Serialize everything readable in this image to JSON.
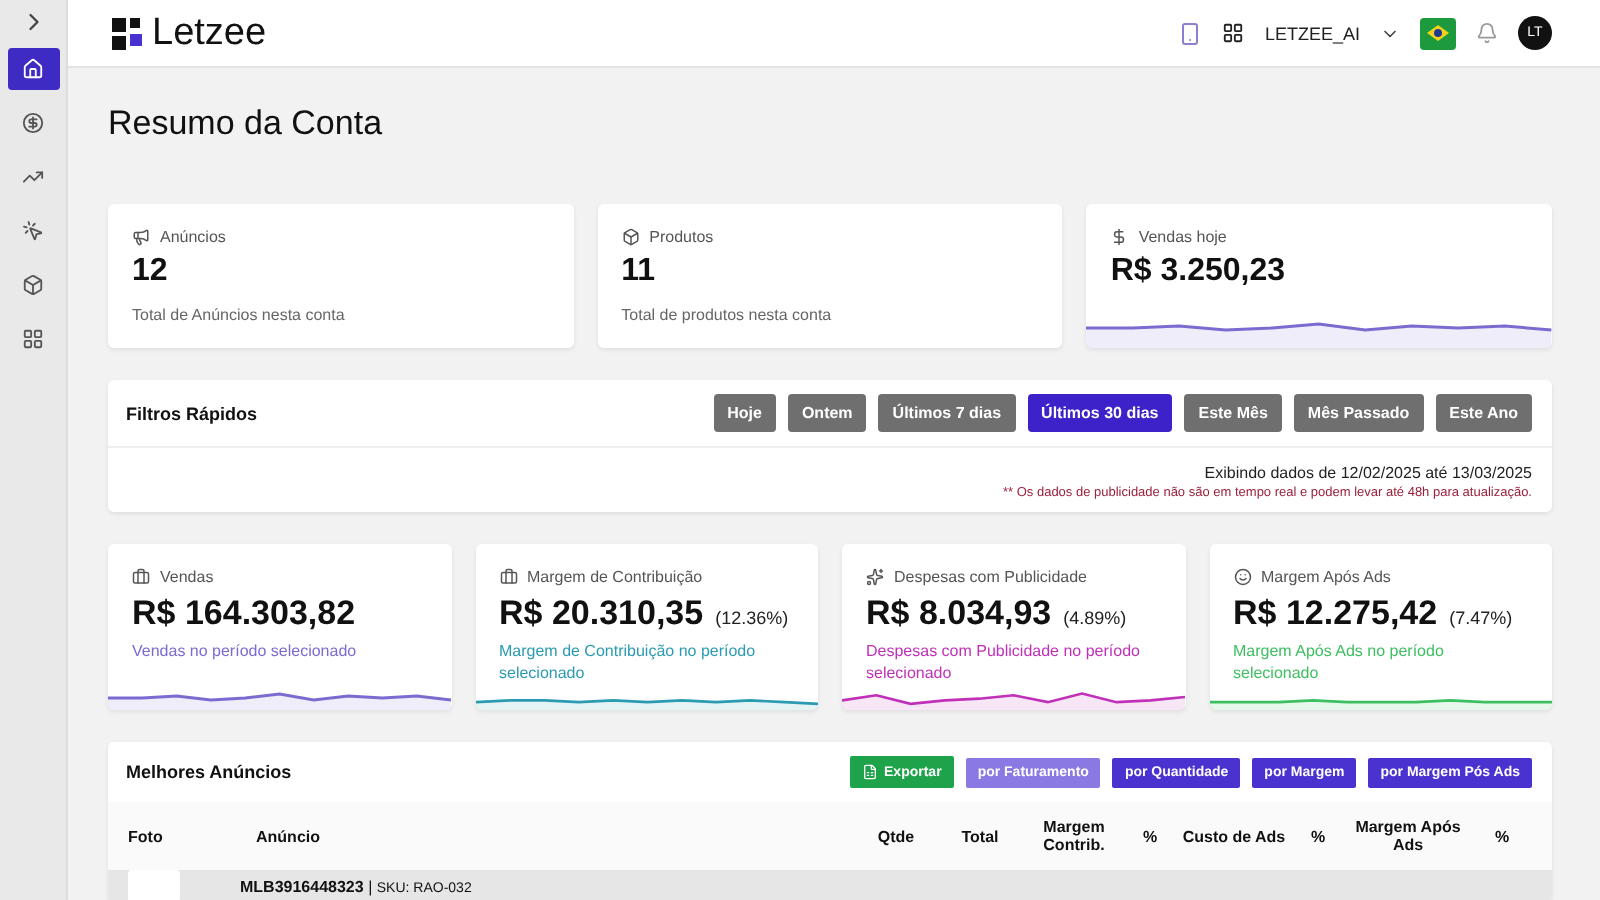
{
  "header": {
    "logo": "Letzee",
    "account": "LETZEE_AI",
    "avatar": "LT"
  },
  "sidebar": {
    "items": [
      {
        "kind": "home",
        "selected": true
      },
      {
        "kind": "money",
        "selected": false
      },
      {
        "kind": "trend",
        "selected": false
      },
      {
        "kind": "click",
        "selected": false
      },
      {
        "kind": "box",
        "selected": false
      },
      {
        "kind": "grid",
        "selected": false
      }
    ]
  },
  "title": "Resumo da Conta",
  "summary_cards": [
    {
      "kind": "ads",
      "label": "Anúncios",
      "value": "12",
      "note": "Total de Anúncios nesta conta"
    },
    {
      "kind": "products",
      "label": "Produtos",
      "value": "11",
      "note": "Total de produtos nesta conta"
    },
    {
      "kind": "sales",
      "label": "Vendas hoje",
      "value": "R$ 3.250,23"
    }
  ],
  "quick_filters": {
    "title": "Filtros Rápidos",
    "buttons": [
      {
        "label": "Hoje",
        "selected": false
      },
      {
        "label": "Ontem",
        "selected": false
      },
      {
        "label": "Últimos 7 dias",
        "selected": false
      },
      {
        "label": "Últimos 30 dias",
        "selected": true
      },
      {
        "label": "Este Mês",
        "selected": false
      },
      {
        "label": "Mês Passado",
        "selected": false
      },
      {
        "label": "Este Ano",
        "selected": false
      }
    ],
    "range": "Exibindo dados de 12/02/2025 até 13/03/2025",
    "notice": "** Os dados de publicidade não são em tempo real e podem levar até 48h para atualização."
  },
  "metrics": [
    {
      "kind": "sales",
      "label": "Vendas",
      "value": "R$ 164.303,82",
      "note": "Vendas no período selecionado",
      "color": "#7b6bd0"
    },
    {
      "kind": "margin",
      "label": "Margem de Contribuição",
      "value": "R$ 20.310,35",
      "percent": "(12.36%)",
      "note": "Margem de Contribuição no período selecionado",
      "color": "#2a9bb0"
    },
    {
      "kind": "ads",
      "label": "Despesas com Publicidade",
      "value": "R$ 8.034,93",
      "percent": "(4.89%)",
      "note": "Despesas com Publicidade no período selecionado",
      "color": "#c030b8"
    },
    {
      "kind": "after",
      "label": "Margem Após Ads",
      "value": "R$ 12.275,42",
      "percent": "(7.47%)",
      "note": "Margem Após Ads no período selecionado",
      "color": "#3cbf60"
    }
  ],
  "best_ads": {
    "title": "Melhores Anúncios",
    "export": "Exportar",
    "sorts": [
      {
        "label": "por Faturamento",
        "selected": true
      },
      {
        "label": "por Quantidade",
        "selected": false
      },
      {
        "label": "por Margem",
        "selected": false
      },
      {
        "label": "por Margem Pós Ads",
        "selected": false
      }
    ],
    "columns": [
      "Foto",
      "Anúncio",
      "Qtde",
      "Total",
      "Margem Contrib.",
      "%",
      "Custo de Ads",
      "%",
      "Margem Após Ads",
      "%"
    ],
    "rows": [
      {
        "id": "MLB3916448323",
        "separator": "|",
        "sku": "SKU: RAO-032"
      }
    ]
  }
}
